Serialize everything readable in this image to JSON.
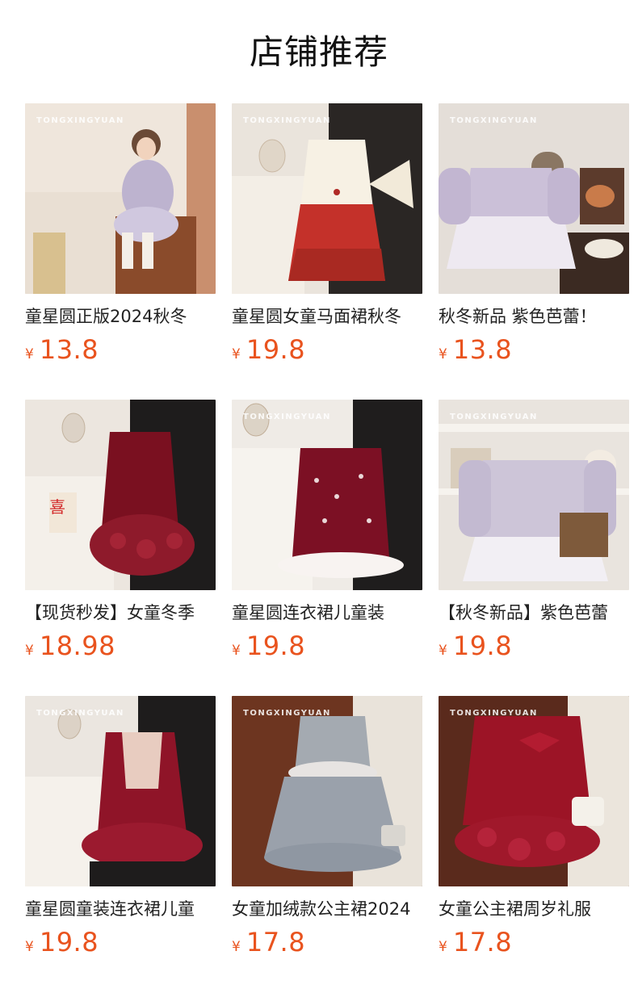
{
  "section": {
    "title": "店铺推荐"
  },
  "currency_symbol": "¥",
  "accent_color": "#e9531e",
  "watermark": "TONGXINGYUAN",
  "products": [
    {
      "name": "童星圆正版2024秋冬",
      "price": "13.8"
    },
    {
      "name": "童星圆女童马面裙秋冬",
      "price": "19.8"
    },
    {
      "name": "秋冬新品 紫色芭蕾！",
      "price": "13.8"
    },
    {
      "name": "【现货秒发】女童冬季",
      "price": "18.98"
    },
    {
      "name": "童星圆连衣裙儿童装",
      "price": "19.8"
    },
    {
      "name": "【秋冬新品】紫色芭蕾",
      "price": "19.8"
    },
    {
      "name": "童星圆童装连衣裙儿童",
      "price": "19.8"
    },
    {
      "name": "女童加绒款公主裙2024",
      "price": "17.8"
    },
    {
      "name": "女童公主裙周岁礼服",
      "price": "17.8"
    }
  ]
}
